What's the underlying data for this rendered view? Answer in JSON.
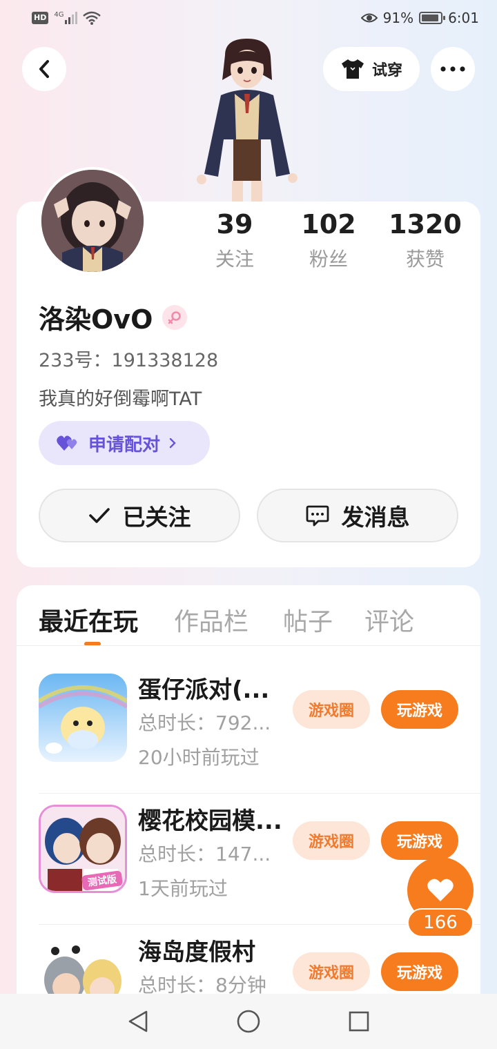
{
  "status_bar": {
    "network_badge": "HD",
    "network_type": "4G",
    "battery_percent": "91%",
    "battery_level": 0.91,
    "time": "6:01"
  },
  "header": {
    "back_icon": "chevron-left-icon",
    "try_on_label": "试穿",
    "try_on_icon": "tshirt-icon",
    "more_icon": "ellipsis-icon"
  },
  "profile": {
    "stats": [
      {
        "value": "39",
        "label": "关注"
      },
      {
        "value": "102",
        "label": "粉丝"
      },
      {
        "value": "1320",
        "label": "获赞"
      }
    ],
    "name": "洛染OvO",
    "gender_icon": "female-icon",
    "uid": "233号：191338128",
    "bio": "我真的好倒霉啊TAT",
    "pair_label": "申请配对",
    "follow_label": "已关注",
    "message_label": "发消息"
  },
  "tabs": [
    "最近在玩",
    "作品栏",
    "帖子",
    "评论"
  ],
  "games": [
    {
      "title": "蛋仔派对(...",
      "duration": "总时长：792...",
      "last_played": "20小时前玩过",
      "circle_label": "游戏圈",
      "play_label": "玩游戏"
    },
    {
      "title": "樱花校园模...",
      "duration": "总时长：147...",
      "last_played": "1天前玩过",
      "circle_label": "游戏圈",
      "play_label": "玩游戏",
      "icon_badge": "测试版"
    },
    {
      "title": "海岛度假村",
      "duration": "总时长：8分钟",
      "last_played": "",
      "circle_label": "游戏圈",
      "play_label": "玩游戏"
    }
  ],
  "like": {
    "count": "166",
    "icon": "heart-icon"
  },
  "nav": {
    "back": "triangle-back-icon",
    "home": "circle-home-icon",
    "recents": "square-recents-icon"
  },
  "colors": {
    "accent": "#f67c1e",
    "pair_purple": "#6653d8",
    "circle_tag_bg": "#fde6d8"
  }
}
